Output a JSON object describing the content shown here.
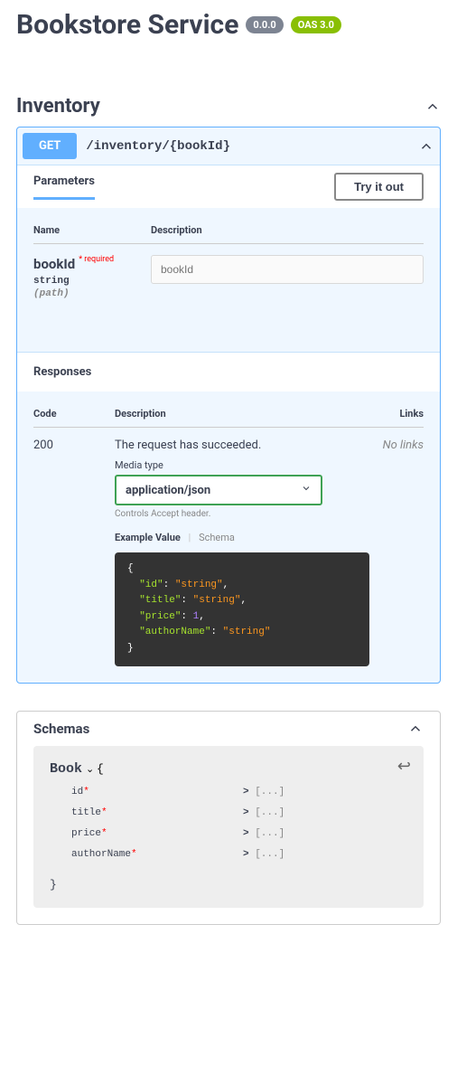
{
  "title": "Bookstore Service",
  "version": "0.0.0",
  "oas": "OAS 3.0",
  "tag": {
    "name": "Inventory"
  },
  "op": {
    "method": "GET",
    "path": "/inventory/{bookId}",
    "params_label": "Parameters",
    "try_label": "Try it out",
    "cols": {
      "name": "Name",
      "desc": "Description"
    },
    "param": {
      "name": "bookId",
      "required": "* required",
      "type": "string",
      "in": "(path)",
      "placeholder": "bookId"
    },
    "responses_label": "Responses",
    "resp_cols": {
      "code": "Code",
      "desc": "Description",
      "links": "Links"
    },
    "response": {
      "code": "200",
      "msg": "The request has succeeded.",
      "no_links": "No links",
      "media_type_label": "Media type",
      "media_type": "application/json",
      "media_note": "Controls Accept header.",
      "tab_example": "Example Value",
      "tab_schema": "Schema",
      "example": {
        "id": "\"string\"",
        "title": "\"string\"",
        "price": "1",
        "authorName": "\"string\""
      }
    }
  },
  "schemas": {
    "label": "Schemas",
    "model": {
      "name": "Book",
      "props": [
        {
          "name": "id",
          "required": true
        },
        {
          "name": "title",
          "required": true
        },
        {
          "name": "price",
          "required": true
        },
        {
          "name": "authorName",
          "required": true
        }
      ]
    }
  }
}
